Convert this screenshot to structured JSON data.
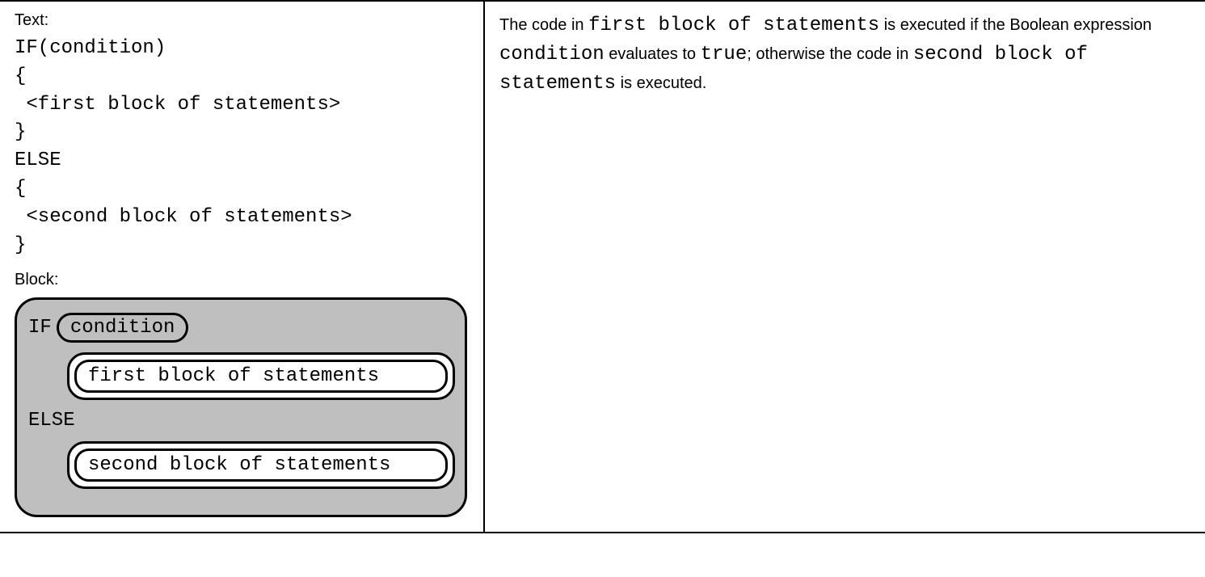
{
  "left": {
    "text_label": "Text:",
    "code_lines": "IF(condition)\n{\n <first block of statements>\n}\nELSE\n{\n <second block of statements>\n}",
    "block_label": "Block:",
    "block": {
      "if_kw": "IF",
      "condition": "condition",
      "first_block": "first block of statements",
      "else_kw": "ELSE",
      "second_block": "second block of statements"
    }
  },
  "right": {
    "p1_a": "The code in ",
    "p1_b": "first block of statements",
    "p1_c": " is executed if the Boolean expression ",
    "p1_d": "condition",
    "p1_e": " evaluates to ",
    "p1_f": "true",
    "p1_g": "; otherwise the code in ",
    "p1_h": "second block of statements",
    "p1_i": " is executed."
  }
}
